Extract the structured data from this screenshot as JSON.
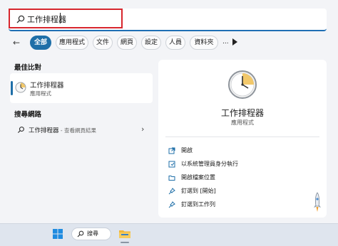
{
  "search": {
    "query": "工作排程器"
  },
  "filters": {
    "tabs": [
      {
        "label": "全部",
        "active": true
      },
      {
        "label": "應用程式",
        "active": false
      },
      {
        "label": "文件",
        "active": false
      },
      {
        "label": "網頁",
        "active": false
      },
      {
        "label": "設定",
        "active": false
      },
      {
        "label": "人員",
        "active": false
      },
      {
        "label": "資料夾",
        "active": false
      },
      {
        "label": "...",
        "active": false
      }
    ]
  },
  "best_match": {
    "heading": "最佳比對",
    "name": "工作排程器",
    "type": "應用程式"
  },
  "web_search": {
    "heading": "搜尋網路",
    "query": "工作排程器",
    "hint": " - 查看網頁結果"
  },
  "details": {
    "title": "工作排程器",
    "type": "應用程式",
    "actions": [
      {
        "label": "開啟",
        "icon": "open-external-icon"
      },
      {
        "label": "以系統管理員身分執行",
        "icon": "admin-shield-icon"
      },
      {
        "label": "開啟檔案位置",
        "icon": "folder-icon"
      },
      {
        "label": "釘選到 [開始]",
        "icon": "pin-icon"
      },
      {
        "label": "釘選到工作列",
        "icon": "pin-icon"
      }
    ]
  },
  "taskbar": {
    "search_label": "搜尋"
  },
  "colors": {
    "accent": "#1f6fa8",
    "highlight_border": "#d7262d",
    "clock_face": "#f2c86a"
  }
}
